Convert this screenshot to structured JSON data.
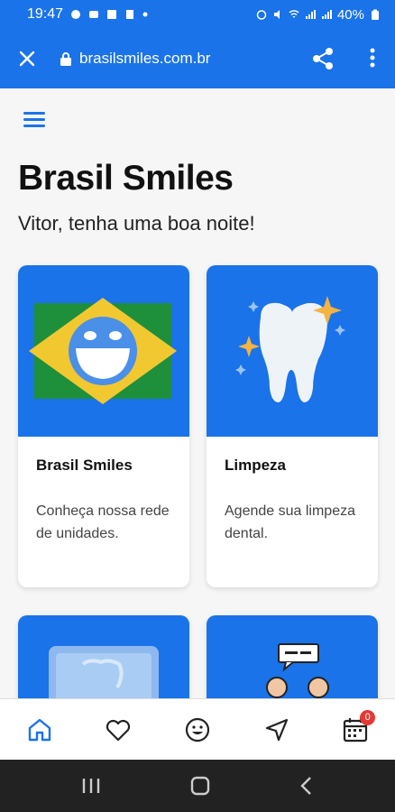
{
  "status_bar": {
    "time": "19:47",
    "battery": "40%"
  },
  "url_bar": {
    "url": "brasilsmiles.com.br"
  },
  "page": {
    "title": "Brasil Smiles",
    "greeting": "Vitor, tenha uma boa noite!"
  },
  "cards": [
    {
      "title": "Brasil Smiles",
      "description": "Conheça nossa rede de unidades."
    },
    {
      "title": "Limpeza",
      "description": "Agende sua limpeza dental."
    }
  ],
  "bottom_nav": {
    "items": [
      "home-icon",
      "heart-icon",
      "smile-icon",
      "navigation-icon",
      "calendar-icon"
    ],
    "calendar_badge": "0"
  },
  "colors": {
    "primary": "#1a73e8",
    "badge": "#e53935",
    "flag_green": "#1e8f3b",
    "flag_yellow": "#f2c830",
    "sparkle": "#f5b342"
  }
}
